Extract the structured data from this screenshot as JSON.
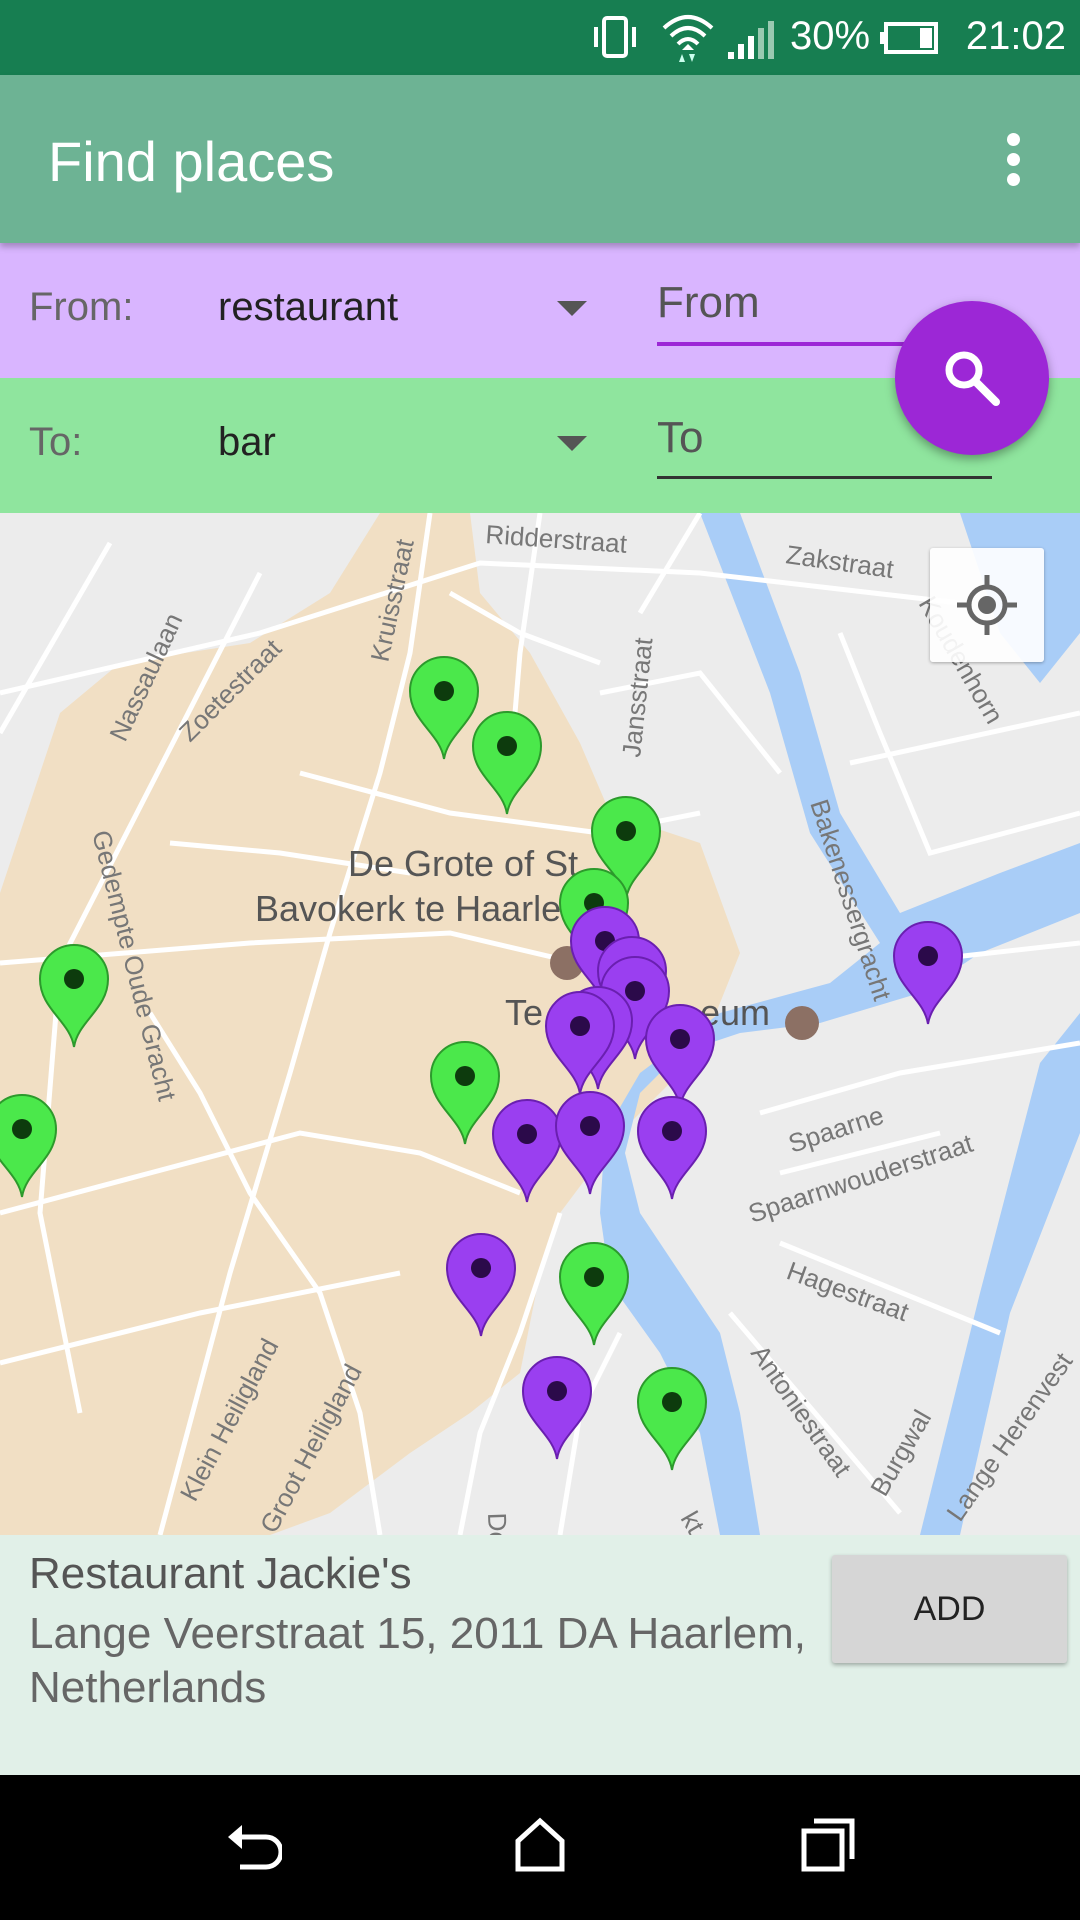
{
  "status_bar": {
    "battery_percent": "30%",
    "time": "21:02",
    "icons": [
      "vibrate-icon",
      "wifi-icon",
      "signal-icon",
      "battery-icon"
    ]
  },
  "app_bar": {
    "title": "Find places",
    "menu_icon": "more-vert-icon"
  },
  "from_row": {
    "label": "From:",
    "selected": "restaurant",
    "input_placeholder": "From",
    "input_value": ""
  },
  "to_row": {
    "label": "To:",
    "selected": "bar",
    "input_placeholder": "To",
    "input_value": ""
  },
  "search_button": {
    "icon": "search-icon"
  },
  "map": {
    "streets": [
      "Ridderstraat",
      "Zakstraat",
      "Koudenhorn",
      "Kruisstraat",
      "Nassaulaan",
      "Zoetestraat",
      "Jansstraat",
      "Bakenessergracht",
      "Gedempte Oude Gracht",
      "Spaarne",
      "Spaarnwouderstraat",
      "Hagestraat",
      "Antoniestraat",
      "Burgwal",
      "Klein Heiligland",
      "Groot Heiligland",
      "De W",
      "Lange Herenvest",
      "kt"
    ],
    "poi_labels": [
      "De Grote of St.",
      "Bavokerk te Haarle",
      "Te",
      "eum"
    ],
    "marker_colors": {
      "restaurant": "#4be84b",
      "bar": "#9a3ff0"
    },
    "restaurant_marker_count": 9,
    "bar_marker_count": 12,
    "locate_icon": "my-location-icon"
  },
  "info_panel": {
    "place_name": "Restaurant Jackie's",
    "address": "Lange Veerstraat 15, 2011 DA Haarlem, Netherlands",
    "add_label": "ADD"
  },
  "nav_bar": {
    "icons": [
      "back-icon",
      "home-icon",
      "recents-icon"
    ]
  },
  "colors": {
    "status_bar": "#177e51",
    "app_bar": "#6db394",
    "from_row": "#d9b5ff",
    "to_row": "#8fe59e",
    "accent": "#9c27d6",
    "info_panel": "#e1f0e8"
  }
}
